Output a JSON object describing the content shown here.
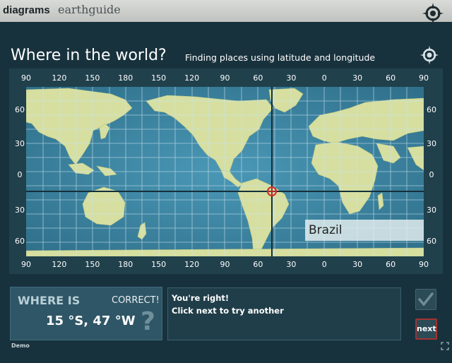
{
  "header": {
    "brand_primary": "diagrams",
    "brand_secondary": "earthguide"
  },
  "page": {
    "title": "Where in the world?",
    "subtitle": "Finding places using latitude and longitude"
  },
  "map": {
    "top_ticks": [
      "90",
      "120",
      "150",
      "180",
      "150",
      "120",
      "90",
      "60",
      "30",
      "0",
      "30",
      "60",
      "90"
    ],
    "bottom_ticks": [
      "90",
      "120",
      "150",
      "180",
      "150",
      "120",
      "90",
      "60",
      "30",
      "0",
      "30",
      "60",
      "90"
    ],
    "left_ticks": [
      "60",
      "30",
      "0",
      "30",
      "60"
    ],
    "right_ticks": [
      "60",
      "30",
      "0",
      "30",
      "60"
    ],
    "country_label": "Brazil",
    "colors": {
      "ocean": "#3f8aa8",
      "land": "#d6dfa0",
      "grid": "#c9e2ec",
      "crosshair": "#14303b",
      "marker": "#cc2a2a"
    }
  },
  "where_panel": {
    "title": "WHERE IS",
    "status": "CORRECT!",
    "coords": "15 °S, 47 °W",
    "help_symbol": "?"
  },
  "feedback": {
    "line1": "You're right!",
    "line2": "Click next to try another"
  },
  "controls": {
    "check_icon": "check-icon",
    "next_label": "next",
    "expand_icon": "expand-icon"
  },
  "footer": {
    "demo_label": "Demo"
  }
}
